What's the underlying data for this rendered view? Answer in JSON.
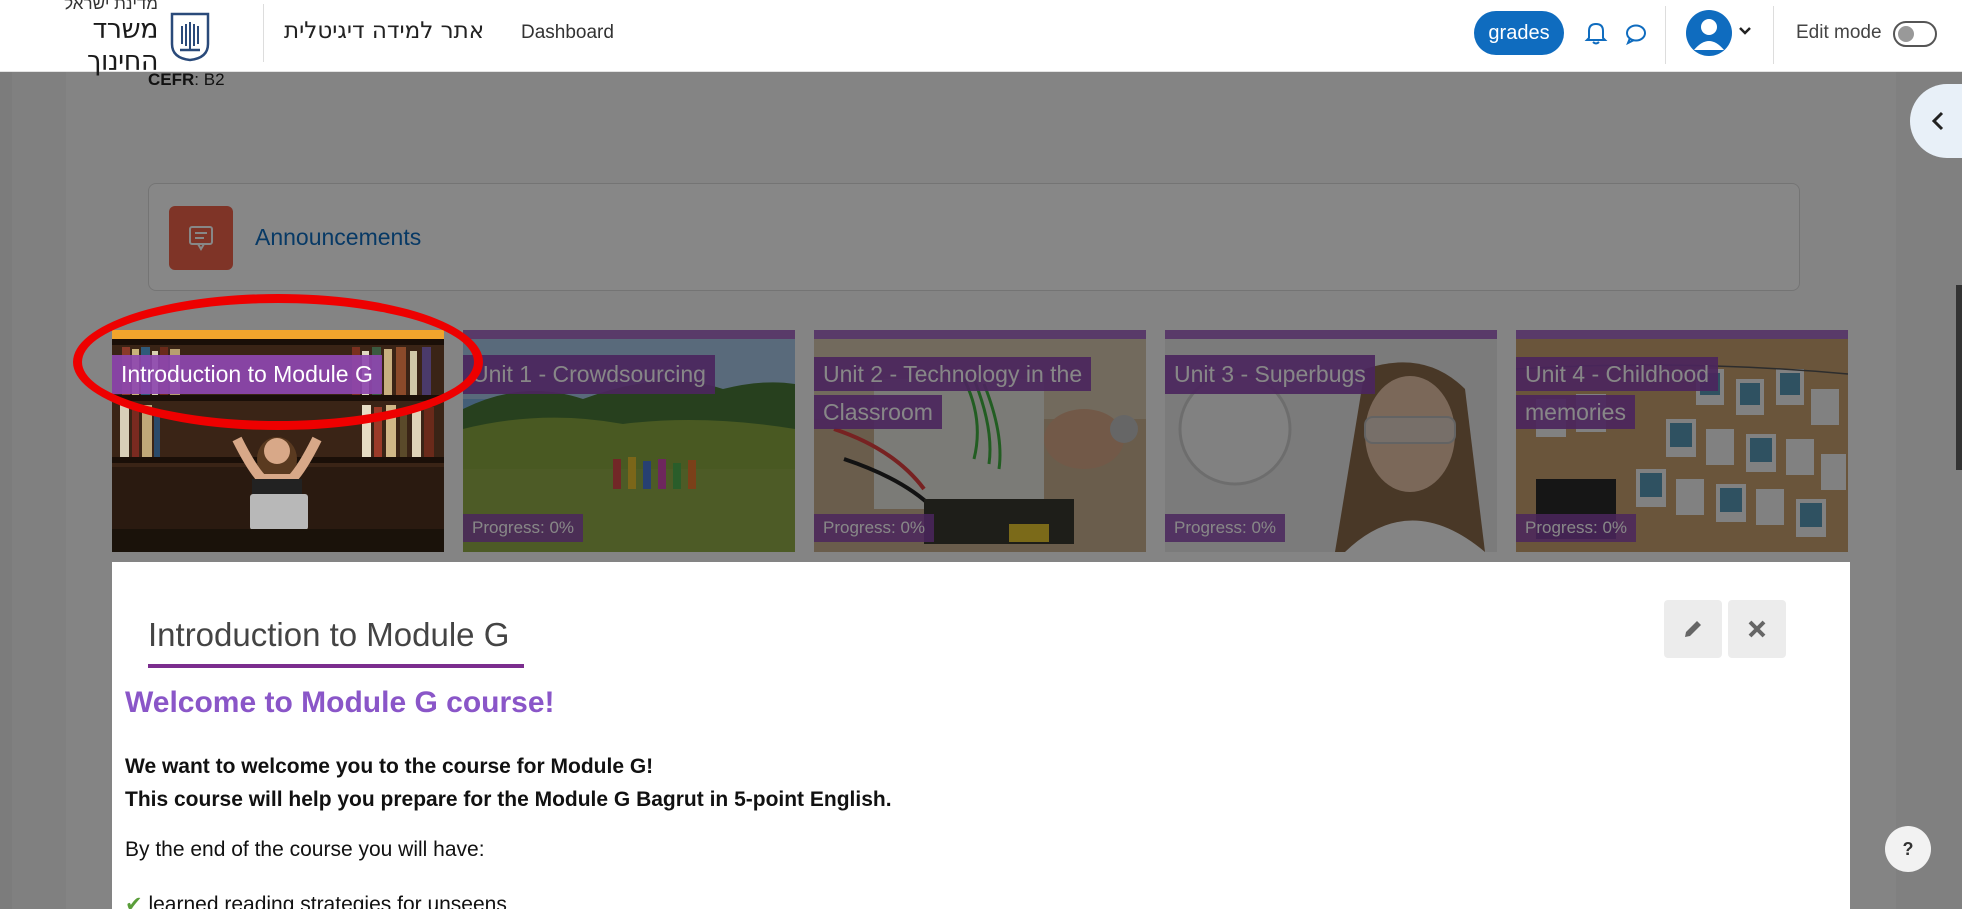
{
  "navbar": {
    "brand_top": "מדינת ישראל",
    "brand_main": "משרד החינוך",
    "site_link": "אתר למידה דיגיטלית",
    "dashboard": "Dashboard",
    "grades": "grades",
    "edit_mode": "Edit mode",
    "icons": [
      "emblem-icon",
      "bell-icon",
      "chat-icon",
      "user-avatar-icon",
      "chevron-down-icon"
    ]
  },
  "course": {
    "cefr_label": "CEFR",
    "cefr_value": ": B2",
    "announcements": "Announcements"
  },
  "tiles": [
    {
      "title": "Introduction to Module G",
      "progress": ""
    },
    {
      "title": "Unit 1 - Crowdsourcing",
      "progress": "Progress: 0%"
    },
    {
      "title_line1": "Unit 2 - Technology in the",
      "title_line2": "Classroom",
      "progress": "Progress: 0%"
    },
    {
      "title": "Unit 3 - Superbugs",
      "progress": "Progress: 0%"
    },
    {
      "title_line1": "Unit 4 - Childhood",
      "title_line2": "memories",
      "progress": "Progress: 0%"
    }
  ],
  "section": {
    "title": "Introduction to Module G",
    "welcome": "Welcome to Module G course!",
    "line1": "We want to welcome you to the course for Module G!",
    "line2": "This course will help you prepare for the Module G Bagrut in 5-point English.",
    "intro": "By the end of the course you will have:",
    "bullet1": "learned reading strategies for unseens"
  },
  "help": "?",
  "colors": {
    "accent": "#0f6cbf",
    "tile_purple": "#a96ec7",
    "active_tile": "#f2a52c",
    "welcome_purple": "#8a56c8",
    "annotation_red": "#ee0000"
  }
}
